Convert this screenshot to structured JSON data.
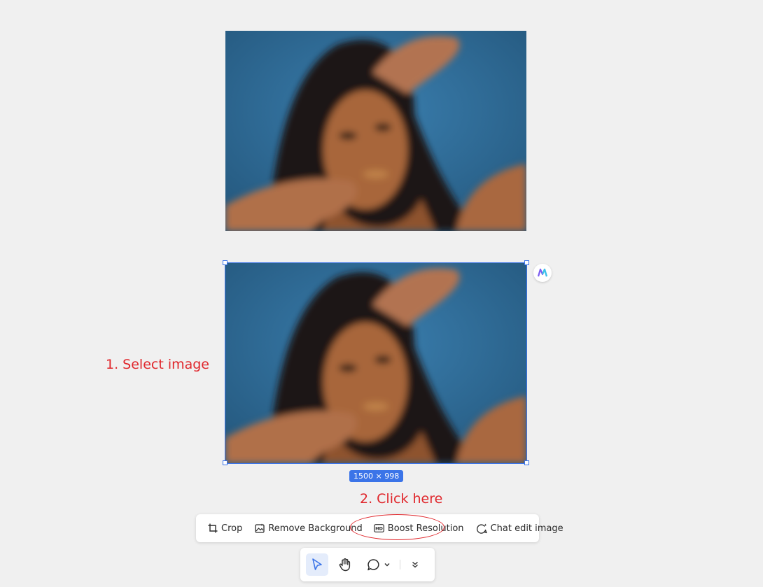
{
  "canvas": {
    "images": [
      {
        "description_icon": "photo-woman-blue-background"
      },
      {
        "description_icon": "photo-woman-blue-background",
        "selected": true,
        "dimensions_label": "1500 × 998"
      }
    ],
    "ai_badge_icon": "ai-assistant-icon"
  },
  "annotations": {
    "step1": "1. Select image",
    "step2": "2. Click here",
    "highlight_color": "#e0262b"
  },
  "image_toolbar": {
    "crop": "Crop",
    "remove_background": "Remove Background",
    "boost_resolution": "Boost Resolution",
    "chat_edit": "Chat edit image"
  },
  "mode_toolbar": {
    "tools": [
      "select-icon",
      "hand-icon",
      "comment-icon",
      "chevron-down-icon",
      "collapse-icon"
    ],
    "active_tool": "select"
  },
  "colors": {
    "accent": "#3b74e8",
    "background": "#f0f0f0"
  }
}
